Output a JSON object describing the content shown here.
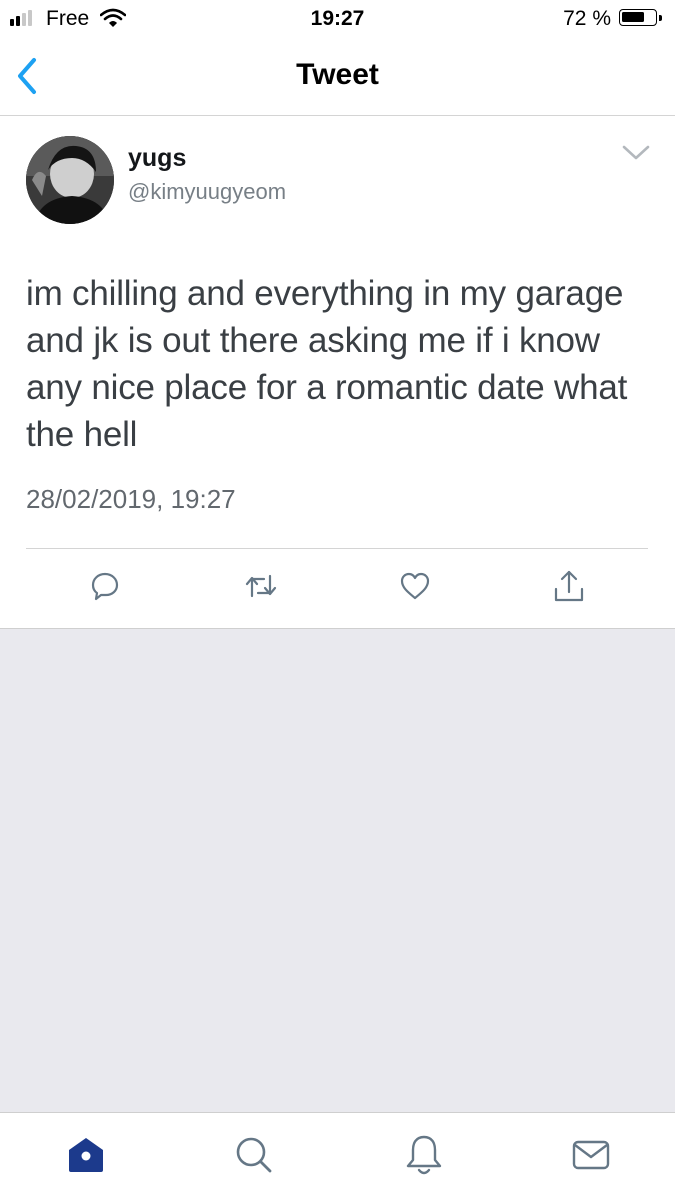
{
  "status_bar": {
    "carrier": "Free",
    "time": "19:27",
    "battery_percent": "72 %",
    "battery_level": 0.72,
    "signal_bars": 2
  },
  "nav": {
    "title": "Tweet",
    "back_icon": "chevron-left-icon"
  },
  "tweet": {
    "display_name": "yugs",
    "handle": "@kimyuugyeom",
    "text": "im chilling and everything in my garage and jk is out there asking me if i know any nice place for a romantic date what the hell",
    "timestamp": "28/02/2019, 19:27",
    "actions": [
      "reply-icon",
      "retweet-icon",
      "like-icon",
      "share-icon"
    ]
  },
  "tab_bar": {
    "tabs": [
      "home-icon",
      "search-icon",
      "notifications-icon",
      "messages-icon"
    ],
    "active": "home-icon"
  },
  "colors": {
    "accent": "#1da1f2",
    "active_tab": "#1c3a8c",
    "icon_gray": "#657786",
    "empty_background": "#e9e9ee"
  }
}
